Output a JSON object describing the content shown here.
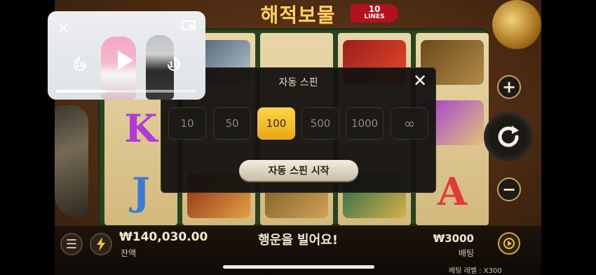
{
  "game": {
    "title": "해적보물",
    "lines_badge_number": "10",
    "lines_badge_text": "LINES"
  },
  "reels": {
    "letters": [
      {
        "char": "K",
        "color": "#b23bd6"
      },
      {
        "char": "J",
        "color": "#3a7bd5"
      },
      {
        "char": "A",
        "color": "#e03a3a"
      }
    ]
  },
  "autospin_modal": {
    "title": "자동 스핀",
    "options": [
      "10",
      "50",
      "100",
      "500",
      "1000",
      "∞"
    ],
    "selected": "100",
    "start_label": "자동 스핀 시작"
  },
  "bottom_bar": {
    "balance_value": "₩140,030.00",
    "balance_label": "잔액",
    "message": "행운을 빌어요!",
    "bet_value": "₩3000",
    "bet_label": "배팅",
    "bet_level": "베팅 레벨 : X300"
  },
  "pip": {
    "rewind_label": "10",
    "forward_label": "10",
    "progress": 0.36
  },
  "colors": {
    "accent": "#f5c23a",
    "modal_bg": "#141210"
  }
}
